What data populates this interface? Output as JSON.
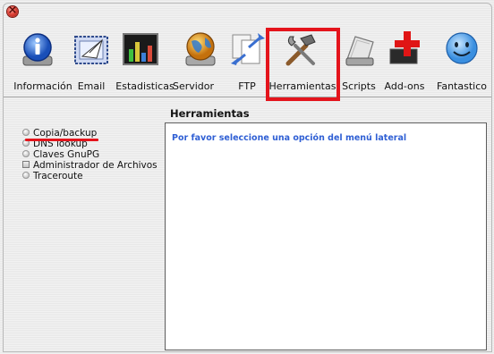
{
  "toolbar": {
    "items": [
      {
        "label": "Información",
        "icon": "info-icon"
      },
      {
        "label": "Email",
        "icon": "email-icon"
      },
      {
        "label": "Estadisticas",
        "icon": "statistics-icon"
      },
      {
        "label": "Servidor",
        "icon": "server-globe-icon"
      },
      {
        "label": "FTP",
        "icon": "ftp-transfer-icon"
      },
      {
        "label": "Herramientas",
        "icon": "tools-icon"
      },
      {
        "label": "Scripts",
        "icon": "scripts-icon"
      },
      {
        "label": "Add-ons",
        "icon": "addons-plus-icon"
      },
      {
        "label": "Fantastico",
        "icon": "smiley-icon"
      }
    ],
    "highlight_color": "#e4141c"
  },
  "sidebar": {
    "items": [
      {
        "label": "Copia/backup"
      },
      {
        "label": "DNS lookup"
      },
      {
        "label": "Claves GnuPG"
      },
      {
        "label": "Administrador de Archivos"
      },
      {
        "label": "Traceroute"
      }
    ]
  },
  "content": {
    "title": "Herramientas",
    "message": "Por favor seleccione una opción del menú lateral",
    "message_color": "#2f5fd4"
  }
}
